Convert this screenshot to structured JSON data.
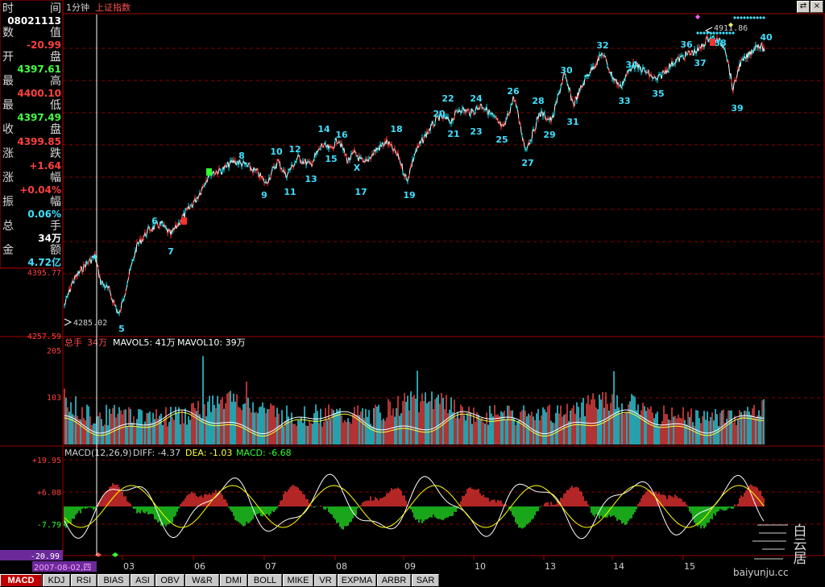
{
  "header": {
    "period": "1分钟",
    "index_name": "上证指数"
  },
  "info_panel": {
    "rows": [
      {
        "label": "时",
        "tail": "间",
        "value": "08021113"
      },
      {
        "label": "数",
        "tail": "值",
        "value": "-20.99",
        "color": "#ff4040"
      },
      {
        "label": "开",
        "tail": "盘",
        "value": "4397.61",
        "color": "#44ff44"
      },
      {
        "label": "最",
        "tail": "高",
        "value": "4400.10",
        "color": "#ff4040"
      },
      {
        "label": "最",
        "tail": "低",
        "value": "4397.49",
        "color": "#44ff44"
      },
      {
        "label": "收",
        "tail": "盘",
        "value": "4399.85",
        "color": "#ff4040"
      },
      {
        "label": "涨",
        "tail": "跌",
        "value": "+1.64",
        "color": "#ff4040"
      },
      {
        "label": "涨",
        "tail": "幅",
        "value": "+0.04%",
        "color": "#ff4040"
      },
      {
        "label": "振",
        "tail": "幅",
        "value": "0.06%",
        "color": "#40e0ff"
      },
      {
        "label": "总",
        "tail": "手",
        "value": "34万"
      },
      {
        "label": "金",
        "tail": "额",
        "value": "4.72亿",
        "color": "#40e0ff"
      }
    ]
  },
  "main_axis": {
    "ticks": [
      "4395.77",
      "4257.59"
    ]
  },
  "annotations": {
    "low_label": "4285.02",
    "high_label": "4911.86"
  },
  "wave_labels": [
    "5",
    "6",
    "7",
    "8",
    "9",
    "10",
    "11",
    "12",
    "13",
    "14",
    "15",
    "16",
    "X",
    "17",
    "18",
    "19",
    "20",
    "21",
    "22",
    "23",
    "24",
    "25",
    "26",
    "27",
    "28",
    "29",
    "30",
    "31",
    "32",
    "33",
    "34",
    "35",
    "36",
    "37",
    "38",
    "39",
    "40"
  ],
  "volume_panel": {
    "header": {
      "total_label": "总手",
      "total_value": "34万",
      "mavol5": "MAVOL5: 41万",
      "mavol10": "MAVOL10: 39万"
    },
    "ticks": [
      "205",
      "103"
    ]
  },
  "macd_panel": {
    "header": {
      "name": "MACD(12,26,9)",
      "diff": "DIFF: -4.37",
      "dea": "DEA: -1.03",
      "macd": "MACD: -6.68"
    },
    "ticks": [
      "+19.95",
      "+6.08",
      "-7.79"
    ],
    "cursor_value": "-20.99"
  },
  "time_axis": {
    "date": "2007-08-02,四",
    "labels": [
      "03",
      "06",
      "07",
      "08",
      "09",
      "10",
      "13",
      "14",
      "15"
    ]
  },
  "tabs": [
    "MACD",
    "KDJ",
    "RSI",
    "BIAS",
    "ASI",
    "OBV",
    "W&R",
    "DMI",
    "BOLL",
    "MIKE",
    "VR",
    "EXPMA",
    "ARBR",
    "SAR"
  ],
  "watermark": {
    "brand": "baiyunju.cc",
    "chars": "白云居"
  },
  "colors": {
    "up": "#ff3030",
    "down": "#00e5ee",
    "grid": "#8b0000",
    "wave": "#40e0ff",
    "diff": "#ffffff",
    "dea": "#ffff00"
  }
}
